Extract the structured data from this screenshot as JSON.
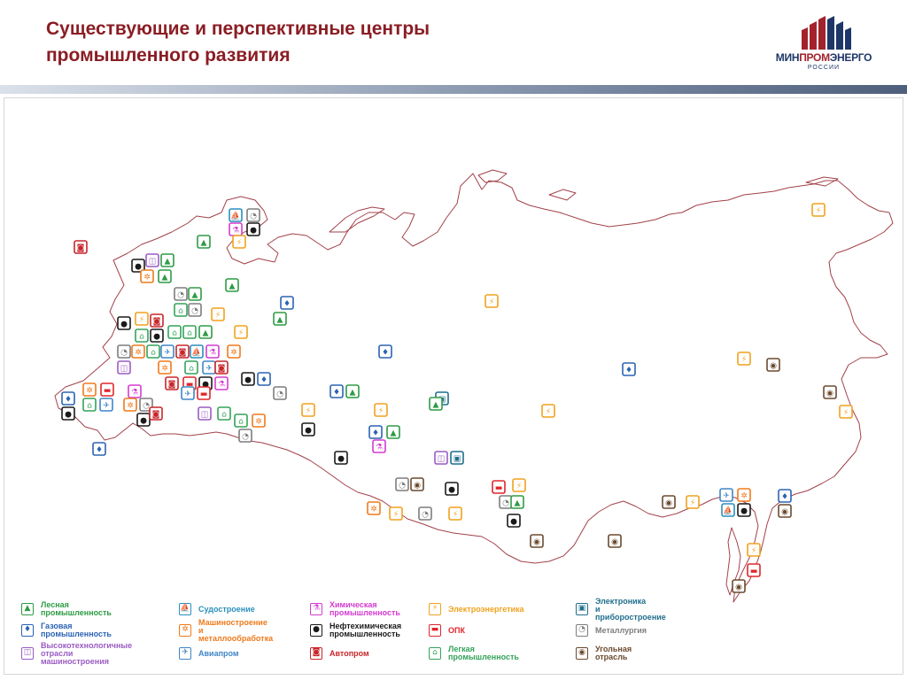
{
  "header": {
    "title_line1": "Существующие и перспективные центры",
    "title_line2": "промышленного развития",
    "logo_text_a": "МИН",
    "logo_text_b": "ПРОМ",
    "logo_text_c": "ЭНЕРГО",
    "logo_sub": "РОССИИ"
  },
  "industries": {
    "forest": {
      "label": "Лесная промышленность",
      "color": "#2e9b45",
      "glyph": "▲"
    },
    "ship": {
      "label": "Судостроение",
      "color": "#2a8fbd",
      "glyph": "⛵"
    },
    "chem": {
      "label": "Химическая\nпромышленность",
      "color": "#d43bd0",
      "glyph": "⚗"
    },
    "power": {
      "label": "Электроэнергетика",
      "color": "#f0a21d",
      "glyph": "⚡"
    },
    "electro": {
      "label": "Электроника\nи приборостроение",
      "color": "#1f6f8c",
      "glyph": "▣"
    },
    "gas": {
      "label": "Газовая промышленность",
      "color": "#2c63b3",
      "glyph": "♦"
    },
    "mach": {
      "label": "Машиностроение\nи металлообработка",
      "color": "#ef7a1c",
      "glyph": "✲"
    },
    "petro": {
      "label": "Нефтехимическая\nпромышленность",
      "color": "#1a1a1a",
      "glyph": "●"
    },
    "opk": {
      "label": "ОПК",
      "color": "#e0262b",
      "glyph": "▬"
    },
    "metal": {
      "label": "Металлургия",
      "color": "#7d7d7d",
      "glyph": "◔"
    },
    "hitech": {
      "label": "Высокотехнологичные\nотрасли машиностроения",
      "color": "#9a5bc4",
      "glyph": "◫"
    },
    "avia": {
      "label": "Авиапром",
      "color": "#3f86c6",
      "glyph": "✈"
    },
    "auto": {
      "label": "Автопром",
      "color": "#c8262b",
      "glyph": "◙"
    },
    "light": {
      "label": "Легкая промышленность",
      "color": "#33a35a",
      "glyph": "⌂"
    },
    "coal": {
      "label": "Угольная отрасль",
      "color": "#6b4a2e",
      "glyph": "◉"
    }
  },
  "legend_order": [
    "forest",
    "gas",
    "hitech",
    "ship",
    "mach",
    "avia",
    "chem",
    "petro",
    "auto",
    "power",
    "opk",
    "light",
    "electro",
    "metal",
    "coal"
  ],
  "markers": [
    {
      "t": "auto"
    },
    {
      "t": "ship"
    },
    {
      "t": "metal"
    },
    {
      "t": "chem"
    },
    {
      "t": "petro"
    },
    {
      "t": "forest"
    },
    {
      "t": "power"
    },
    {
      "t": "petro"
    },
    {
      "t": "hitech"
    },
    {
      "t": "forest"
    },
    {
      "t": "mach"
    },
    {
      "t": "forest"
    },
    {
      "t": "forest"
    },
    {
      "t": "metal"
    },
    {
      "t": "forest"
    },
    {
      "t": "light"
    },
    {
      "t": "metal"
    },
    {
      "t": "power"
    },
    {
      "t": "gas"
    },
    {
      "t": "forest"
    },
    {
      "t": "petro"
    },
    {
      "t": "power"
    },
    {
      "t": "auto"
    },
    {
      "t": "light"
    },
    {
      "t": "petro"
    },
    {
      "t": "light"
    },
    {
      "t": "light"
    },
    {
      "t": "forest"
    },
    {
      "t": "power"
    },
    {
      "t": "metal"
    },
    {
      "t": "mach"
    },
    {
      "t": "light"
    },
    {
      "t": "avia"
    },
    {
      "t": "auto"
    },
    {
      "t": "ship"
    },
    {
      "t": "chem"
    },
    {
      "t": "mach"
    },
    {
      "t": "hitech"
    },
    {
      "t": "mach"
    },
    {
      "t": "light"
    },
    {
      "t": "avia"
    },
    {
      "t": "auto"
    },
    {
      "t": "auto"
    },
    {
      "t": "opk"
    },
    {
      "t": "petro"
    },
    {
      "t": "chem"
    },
    {
      "t": "petro"
    },
    {
      "t": "gas"
    },
    {
      "t": "metal"
    },
    {
      "t": "gas"
    },
    {
      "t": "mach"
    },
    {
      "t": "opk"
    },
    {
      "t": "chem"
    },
    {
      "t": "metal"
    },
    {
      "t": "avia"
    },
    {
      "t": "opk"
    },
    {
      "t": "petro"
    },
    {
      "t": "light"
    },
    {
      "t": "avia"
    },
    {
      "t": "mach"
    },
    {
      "t": "petro"
    },
    {
      "t": "auto"
    },
    {
      "t": "hitech"
    },
    {
      "t": "light"
    },
    {
      "t": "light"
    },
    {
      "t": "mach"
    },
    {
      "t": "metal"
    },
    {
      "t": "gas"
    },
    {
      "t": "gas"
    },
    {
      "t": "forest"
    },
    {
      "t": "power"
    },
    {
      "t": "petro"
    },
    {
      "t": "power"
    },
    {
      "t": "gas"
    },
    {
      "t": "forest"
    },
    {
      "t": "chem"
    },
    {
      "t": "electro"
    },
    {
      "t": "petro"
    },
    {
      "t": "forest"
    },
    {
      "t": "gas"
    },
    {
      "t": "power"
    },
    {
      "t": "gas"
    },
    {
      "t": "power"
    },
    {
      "t": "hitech"
    },
    {
      "t": "electro"
    },
    {
      "t": "metal"
    },
    {
      "t": "coal"
    },
    {
      "t": "petro"
    },
    {
      "t": "opk"
    },
    {
      "t": "power"
    },
    {
      "t": "metal"
    },
    {
      "t": "forest"
    },
    {
      "t": "mach"
    },
    {
      "t": "power"
    },
    {
      "t": "metal"
    },
    {
      "t": "power"
    },
    {
      "t": "petro"
    },
    {
      "t": "coal"
    },
    {
      "t": "coal"
    },
    {
      "t": "power"
    },
    {
      "t": "coal"
    },
    {
      "t": "coal"
    },
    {
      "t": "power"
    },
    {
      "t": "coal"
    },
    {
      "t": "power"
    },
    {
      "t": "avia"
    },
    {
      "t": "mach"
    },
    {
      "t": "ship"
    },
    {
      "t": "petro"
    },
    {
      "t": "gas"
    },
    {
      "t": "coal"
    },
    {
      "t": "power"
    },
    {
      "t": "opk"
    },
    {
      "t": "coal"
    },
    {
      "t": "power"
    }
  ]
}
